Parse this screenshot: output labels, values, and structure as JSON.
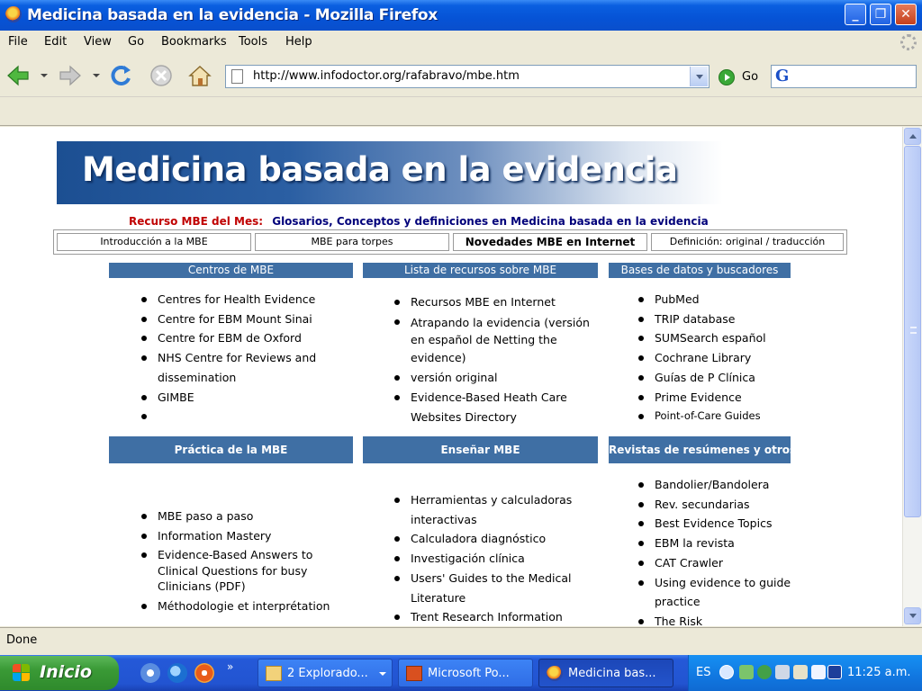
{
  "window": {
    "title": "Medicina basada en la evidencia - Mozilla Firefox",
    "min_icon": "minimize-icon",
    "max_icon": "maximize-icon",
    "close_icon": "close-icon",
    "min_glyph": "_",
    "max_glyph": "❐",
    "close_glyph": "✕"
  },
  "menu": {
    "items": [
      "File",
      "Edit",
      "View",
      "Go",
      "Bookmarks",
      "Tools",
      "Help"
    ]
  },
  "toolbar": {
    "url": "http://www.infodoctor.org/rafabravo/mbe.htm",
    "go_label": "Go",
    "search_engine_glyph": "G",
    "icons": [
      "back-icon",
      "forward-icon",
      "reload-icon",
      "stop-icon",
      "home-icon"
    ]
  },
  "page": {
    "banner_title": "Medicina basada en la evidencia",
    "recurso_label": "Recurso MBE del Mes:",
    "recurso_link": "Glosarios, Conceptos y definiciones en Medicina basada en la evidencia",
    "nav": [
      "Introducción a la MBE",
      "MBE para torpes",
      "Novedades MBE en Internet",
      "Definición: original / traducción"
    ],
    "sections": [
      {
        "title": "Centros de MBE",
        "items": [
          "Centres for Health Evidence",
          "Centre for EBM Mount Sinai",
          "Centre for EBM de Oxford",
          "NHS Centre for Reviews and dissemination",
          "GIMBE",
          ""
        ]
      },
      {
        "title": "Lista de recursos sobre MBE",
        "items": [
          "Recursos MBE en Internet",
          "Atrapando la evidencia (versión en español de Netting the evidence)",
          "versión original",
          "Evidence-Based Heath Care Websites Directory"
        ]
      },
      {
        "title": "Bases de datos y buscadores",
        "items": [
          "PubMed",
          "TRIP database",
          "SUMSearch español",
          "Cochrane Library",
          "Guías de P Clínica",
          "Prime Evidence",
          "Point-of-Care Guides"
        ]
      },
      {
        "title": "Práctica de la MBE",
        "items": [
          "MBE paso a paso",
          "Information Mastery",
          "Evidence-Based Answers to Clinical Questions for busy Clinicians (PDF)",
          "Méthodologie et interprétation"
        ]
      },
      {
        "title": "Enseñar MBE",
        "items": [
          "Herramientas y calculadoras interactivas",
          "Calculadora diagnóstico",
          "Investigación clínica",
          "Users' Guides to the Medical Literature",
          "Trent Research Information"
        ]
      },
      {
        "title": "Revistas de resúmenes y otros",
        "items": [
          "Bandolier/Bandolera",
          "Rev. secundarias",
          "Best Evidence Topics",
          "EBM la revista",
          "CAT Crawler",
          "Using evidence to guide practice",
          "The Risk"
        ]
      }
    ]
  },
  "status": {
    "text": "Done"
  },
  "taskbar": {
    "start_label": "Inicio",
    "chevron": "»",
    "tasks": [
      {
        "label": "2 Explorado...",
        "icon": "folder-icon"
      },
      {
        "label": "Microsoft Po...",
        "icon": "powerpoint-icon"
      },
      {
        "label": "Medicina bas...",
        "icon": "firefox-icon"
      }
    ],
    "lang": "ES",
    "clock": "11:25 a.m."
  },
  "colors": {
    "titlebar": "#0653d6",
    "section_header": "#3f6fa4",
    "recurso_label": "#c00000",
    "recurso_link": "#00007a",
    "start_button": "#3a9a36"
  }
}
